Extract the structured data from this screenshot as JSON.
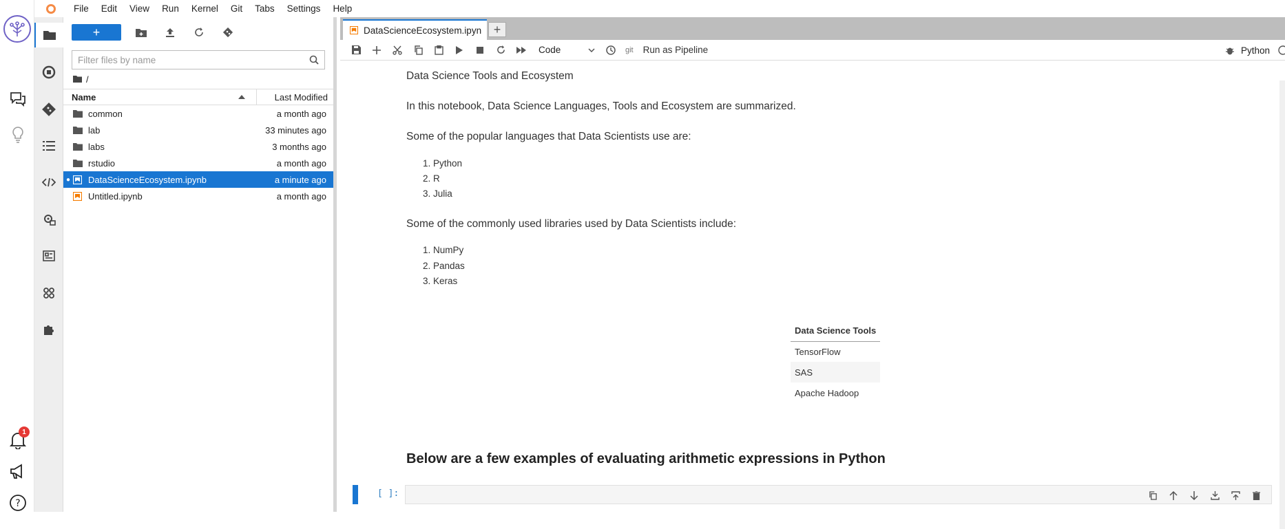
{
  "menubar": {
    "items": [
      "File",
      "Edit",
      "View",
      "Run",
      "Kernel",
      "Git",
      "Tabs",
      "Settings",
      "Help"
    ]
  },
  "rail": {
    "notification_count": "1"
  },
  "filebrowser": {
    "new_label": "+",
    "filter_placeholder": "Filter files by name",
    "breadcrumb": "/",
    "header": {
      "name": "Name",
      "modified": "Last Modified"
    },
    "files": [
      {
        "name": "common",
        "modified": "a month ago",
        "type": "folder"
      },
      {
        "name": "lab",
        "modified": "33 minutes ago",
        "type": "folder"
      },
      {
        "name": "labs",
        "modified": "3 months ago",
        "type": "folder"
      },
      {
        "name": "rstudio",
        "modified": "a month ago",
        "type": "folder"
      },
      {
        "name": "DataScienceEcosystem.ipynb",
        "modified": "a minute ago",
        "type": "notebook",
        "selected": true
      },
      {
        "name": "Untitled.ipynb",
        "modified": "a month ago",
        "type": "notebook"
      }
    ]
  },
  "notebook": {
    "tab_title": "DataScienceEcosystem.ipyn",
    "add_tab": "+",
    "cell_type": "Code",
    "git_label": "git",
    "run_pipeline": "Run as Pipeline",
    "kernel": "Python",
    "content": {
      "title": "Data Science Tools and Ecosystem",
      "intro": "In this notebook, Data Science Languages, Tools and Ecosystem are summarized.",
      "languages_heading": "Some of the popular languages that Data Scientists use are:",
      "languages": [
        "1. Python",
        "2. R",
        "3. Julia"
      ],
      "libraries_heading": "Some of the commonly used libraries used by Data Scientists include:",
      "libraries": [
        "1. NumPy",
        "2. Pandas",
        "3. Keras"
      ],
      "tools_table": {
        "header": "Data Science Tools",
        "rows": [
          "TensorFlow",
          "SAS",
          "Apache Hadoop"
        ]
      },
      "expressions_heading": "Below are a few examples of evaluating arithmetic expressions in Python"
    },
    "code_cell": {
      "prompt": "[ ]:"
    }
  },
  "colors": {
    "accent": "#1976d2",
    "badge": "#e53935",
    "notebook_icon": "#f57c00"
  }
}
